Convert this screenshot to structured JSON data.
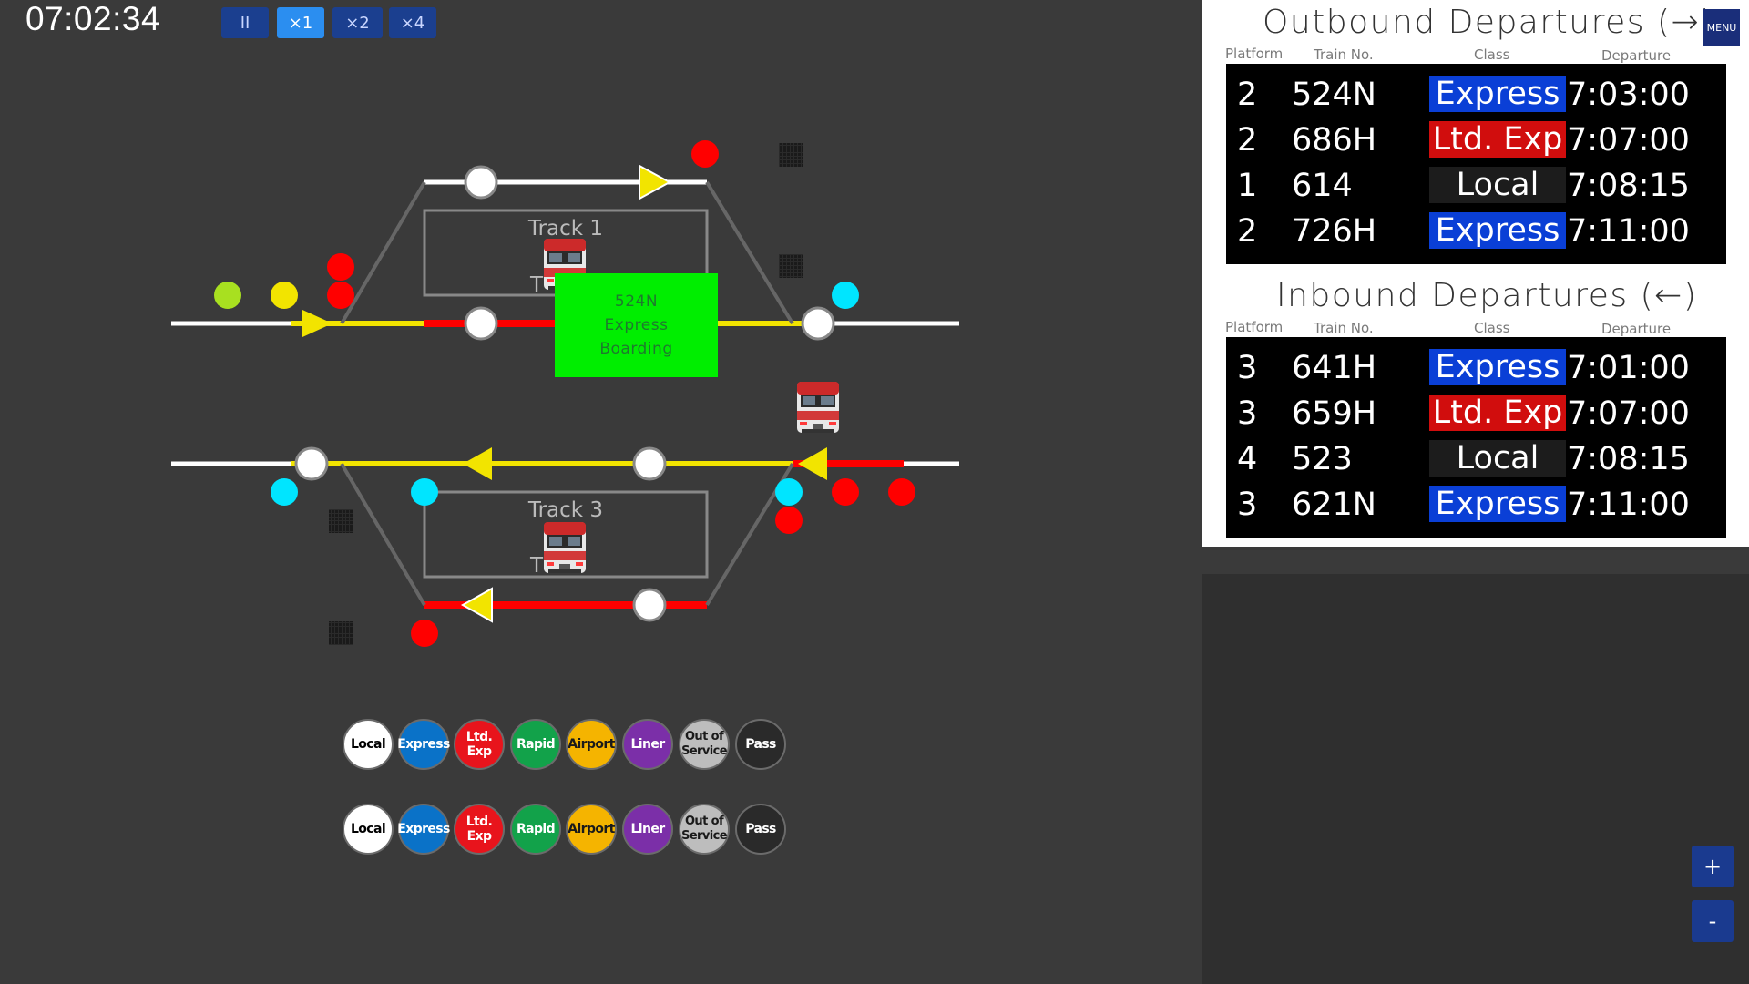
{
  "clock": "07:02:34",
  "speed_controls": [
    {
      "label": "II",
      "active": false
    },
    {
      "label": "×1",
      "active": true
    },
    {
      "label": "×2",
      "active": false
    },
    {
      "label": "×4",
      "active": false
    }
  ],
  "tracks": {
    "track1_label": "Track 1",
    "track3_label": "Track 3",
    "track2_partial": "T",
    "track4_partial": "T     4"
  },
  "boarding_popup": {
    "train": "524N",
    "class": "Express",
    "status": "Boarding"
  },
  "legend_rows": [
    [
      {
        "label": "Local",
        "color": "#ffffff",
        "text_color": "#000000"
      },
      {
        "label": "Express",
        "color": "#0a72c8",
        "text_color": "#ffffff"
      },
      {
        "label": "Ltd. Exp",
        "color": "#e8141c",
        "text_color": "#ffffff"
      },
      {
        "label": "Rapid",
        "color": "#12a24a",
        "text_color": "#ffffff"
      },
      {
        "label": "Airport",
        "color": "#f5b400",
        "text_color": "#1a1a1a"
      },
      {
        "label": "Liner",
        "color": "#7b2fa8",
        "text_color": "#ffffff"
      },
      {
        "label": "Out of Service",
        "color": "#bdbdbd",
        "text_color": "#1a1a1a"
      },
      {
        "label": "Pass",
        "color": "#2a2a2a",
        "text_color": "#ffffff"
      }
    ],
    [
      {
        "label": "Local",
        "color": "#ffffff",
        "text_color": "#000000"
      },
      {
        "label": "Express",
        "color": "#0a72c8",
        "text_color": "#ffffff"
      },
      {
        "label": "Ltd. Exp",
        "color": "#e8141c",
        "text_color": "#ffffff"
      },
      {
        "label": "Rapid",
        "color": "#12a24a",
        "text_color": "#ffffff"
      },
      {
        "label": "Airport",
        "color": "#f5b400",
        "text_color": "#1a1a1a"
      },
      {
        "label": "Liner",
        "color": "#7b2fa8",
        "text_color": "#ffffff"
      },
      {
        "label": "Out of Service",
        "color": "#bdbdbd",
        "text_color": "#1a1a1a"
      },
      {
        "label": "Pass",
        "color": "#2a2a2a",
        "text_color": "#ffffff"
      }
    ]
  ],
  "menu_label": "MENU",
  "columns": {
    "platform": "Platform",
    "train_no": "Train No.",
    "class": "Class",
    "departure": "Departure"
  },
  "outbound": {
    "title": "Outbound Departures (→)",
    "rows": [
      {
        "platform": "2",
        "train": "524N",
        "class": "Express",
        "class_color": "#0a3fd6",
        "departure": "7:03:00"
      },
      {
        "platform": "2",
        "train": "686H",
        "class": "Ltd. Exp",
        "class_color": "#d10d0d",
        "departure": "7:07:00"
      },
      {
        "platform": "1",
        "train": "614",
        "class": "Local",
        "class_color": "#1c1c1c",
        "departure": "7:08:15"
      },
      {
        "platform": "2",
        "train": "726H",
        "class": "Express",
        "class_color": "#0a3fd6",
        "departure": "7:11:00"
      }
    ]
  },
  "inbound": {
    "title": "Inbound Departures (←)",
    "rows": [
      {
        "platform": "3",
        "train": "641H",
        "class": "Express",
        "class_color": "#0a3fd6",
        "departure": "7:01:00"
      },
      {
        "platform": "3",
        "train": "659H",
        "class": "Ltd. Exp",
        "class_color": "#d10d0d",
        "departure": "7:07:00"
      },
      {
        "platform": "4",
        "train": "523",
        "class": "Local",
        "class_color": "#1c1c1c",
        "departure": "7:08:15"
      },
      {
        "platform": "3",
        "train": "621N",
        "class": "Express",
        "class_color": "#0a3fd6",
        "departure": "7:11:00"
      }
    ]
  },
  "zoom": {
    "in": "+",
    "out": "-"
  },
  "colors": {
    "background": "#3a3a3a",
    "track_white": "#ffffff",
    "route_yellow": "#f2e400",
    "occupied_red": "#ff0000",
    "signal_cyan": "#00e5ff",
    "boarding_green": "#00ee00"
  }
}
